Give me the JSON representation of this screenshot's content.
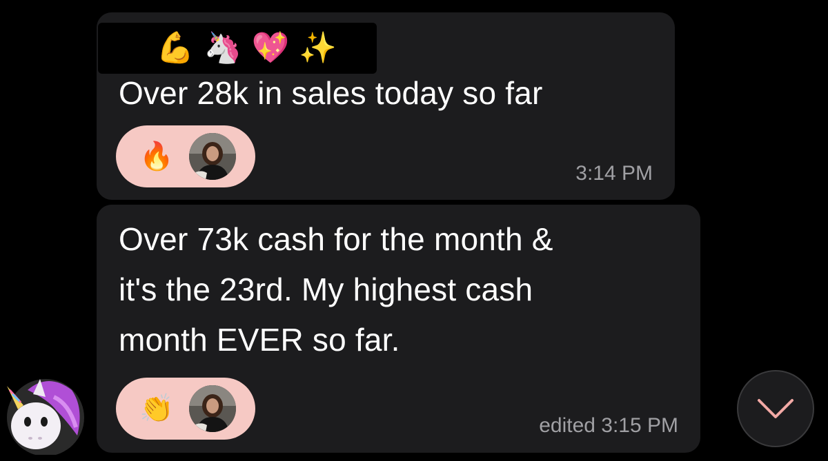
{
  "emoji_strip": {
    "emojis": [
      "⚡",
      "💪",
      "🦄",
      "💖",
      "✨"
    ]
  },
  "messages": [
    {
      "text": "Over 28k in sales today so far",
      "reaction_emoji": "🔥",
      "timestamp": "3:14 PM"
    },
    {
      "text": "Over 73k cash for the month &\nit's the 23rd. My highest cash\nmonth EVER so far.",
      "reaction_emoji": "👏",
      "timestamp": "edited 3:15 PM"
    }
  ],
  "colors": {
    "background": "#000000",
    "bubble": "#1c1c1e",
    "reaction_pill": "#f6c9c4",
    "timestamp": "#a0a0a4",
    "scroll_button_chevron": "#f2a9a5"
  },
  "icons": {
    "sender_avatar": "unicorn-memoji-icon",
    "scroll_down": "chevron-down-icon",
    "reactor": "reactor-avatar-photo"
  }
}
